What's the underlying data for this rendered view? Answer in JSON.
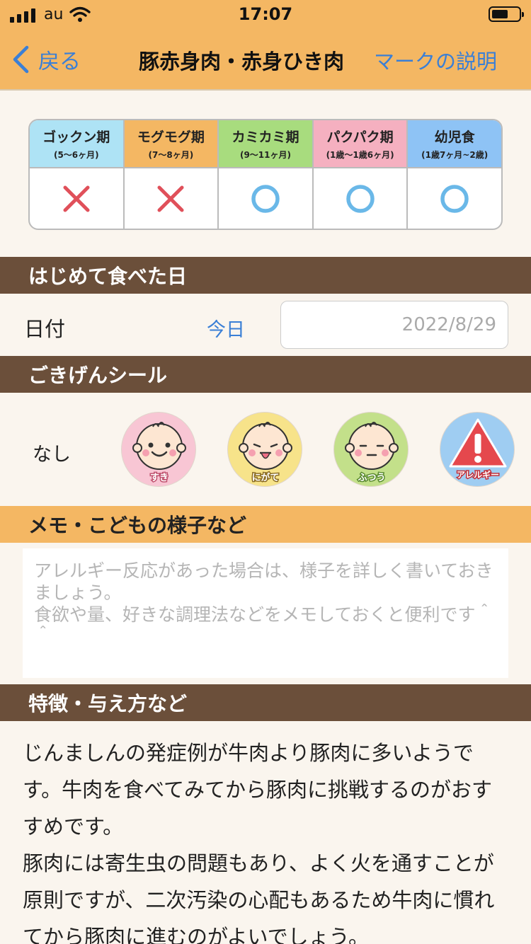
{
  "status": {
    "carrier": "au",
    "time": "17:07",
    "icons": [
      "signal-icon",
      "wifi-icon",
      "battery-icon"
    ]
  },
  "nav": {
    "back_label": "戻る",
    "title": "豚赤身肉・赤身ひき肉",
    "right_label": "マークの説明"
  },
  "stages": [
    {
      "name": "ゴックン期",
      "age": "(5〜6ヶ月)",
      "color": "#aee3f5",
      "mark": "cross"
    },
    {
      "name": "モグモグ期",
      "age": "(7〜8ヶ月)",
      "color": "#f4b763",
      "mark": "cross"
    },
    {
      "name": "カミカミ期",
      "age": "(9〜11ヶ月)",
      "color": "#a8dc7e",
      "mark": "circle"
    },
    {
      "name": "パクパク期",
      "age": "(1歳〜1歳6ヶ月)",
      "color": "#f5b0c0",
      "mark": "circle"
    },
    {
      "name": "幼児食",
      "age": "(1歳7ヶ月~2歳)",
      "color": "#8ec3f5",
      "mark": "circle"
    }
  ],
  "first_day": {
    "header": "はじめて食べた日",
    "date_label": "日付",
    "today_label": "今日",
    "date_value": "2022/8/29"
  },
  "mood": {
    "header": "ごきげんシール",
    "none_label": "なし",
    "stickers": [
      {
        "label": "すき",
        "color": "#f8c6d4",
        "icon": "happy-baby-icon"
      },
      {
        "label": "にがて",
        "color": "#f7e38a",
        "icon": "tongue-baby-icon"
      },
      {
        "label": "ふつう",
        "color": "#c3e08a",
        "icon": "neutral-baby-icon"
      },
      {
        "label": "アレルギー",
        "color": "#9fcdf2",
        "icon": "warning-icon"
      }
    ]
  },
  "memo": {
    "header": "メモ・こどもの様子など",
    "placeholder": "アレルギー反応があった場合は、様子を詳しく書いておきましょう。\n食欲や量、好きな調理法などをメモしておくと便利です＾＾"
  },
  "features": {
    "header": "特徴・与え方など",
    "text": "じんましんの発症例が牛肉より豚肉に多いようです。牛肉を食べてみてから豚肉に挑戦するのがおすすめです。\n豚肉には寄生虫の問題もあり、よく火を通すことが原則ですが、二次汚染の心配もあるため牛肉に慣れてから豚肉に進むのがよいでしょう。"
  },
  "colors": {
    "accent_blue": "#3a7fd6",
    "header_orange": "#f4b763",
    "header_brown": "#6b4f3a",
    "cross_red": "#e0505a",
    "circle_blue": "#6ab8e8"
  }
}
